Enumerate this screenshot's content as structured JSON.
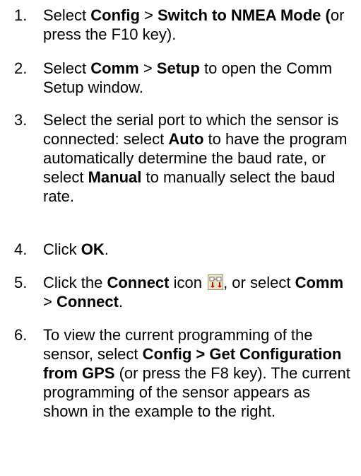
{
  "steps": [
    {
      "num": "1.",
      "parts": [
        {
          "t": "Select ",
          "b": false
        },
        {
          "t": "Config",
          "b": true
        },
        {
          "t": " > ",
          "b": false
        },
        {
          "t": "Switch to NMEA Mode (",
          "b": true
        },
        {
          "t": "or press the F10 key).",
          "b": false
        }
      ]
    },
    {
      "num": "2.",
      "parts": [
        {
          "t": "Select ",
          "b": false
        },
        {
          "t": "Comm",
          "b": true
        },
        {
          "t": " > ",
          "b": false
        },
        {
          "t": "Setup",
          "b": true
        },
        {
          "t": " to open the Comm Setup window.",
          "b": false
        }
      ]
    },
    {
      "num": "3.",
      "parts": [
        {
          "t": "Select the serial port to which the sensor is connected: select ",
          "b": false
        },
        {
          "t": "Auto",
          "b": true
        },
        {
          "t": " to have the program automatically determine the baud rate, or select ",
          "b": false
        },
        {
          "t": "Manual",
          "b": true
        },
        {
          "t": " to manually select the baud rate.",
          "b": false
        }
      ]
    },
    {
      "num": "4.",
      "parts": [
        {
          "t": "Click ",
          "b": false
        },
        {
          "t": "OK",
          "b": true
        },
        {
          "t": ".",
          "b": false
        }
      ]
    },
    {
      "num": "5.",
      "parts": [
        {
          "t": "Click the ",
          "b": false
        },
        {
          "t": "Connect",
          "b": true
        },
        {
          "t": " icon ",
          "b": false
        },
        {
          "icon": "connect-icon"
        },
        {
          "t": ", or select ",
          "b": false
        },
        {
          "t": "Comm",
          "b": true
        },
        {
          "t": " > ",
          "b": false
        },
        {
          "t": "Connect",
          "b": true
        },
        {
          "t": ".",
          "b": false
        }
      ]
    },
    {
      "num": "6.",
      "parts": [
        {
          "t": "To view the current programming of the sensor, select ",
          "b": false
        },
        {
          "t": "Config > Get Configuration from GPS",
          "b": true
        },
        {
          "t": " (or press the F8 key). The current programming of the sensor appears as shown in the example to the right.",
          "b": false
        }
      ]
    }
  ]
}
